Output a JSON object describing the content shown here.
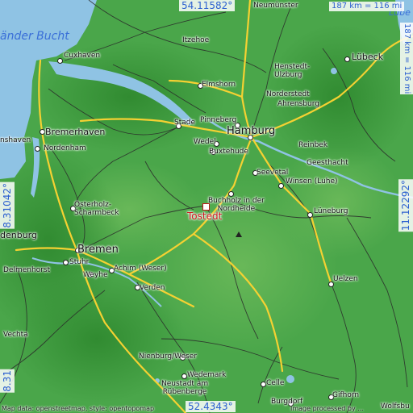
{
  "colors": {
    "water": "#8fc3e4",
    "land_high": "#4aa64a",
    "land_low": "#2f8a2f",
    "road_major": "#f5d132",
    "road_minor": "#2a2a2a",
    "highlight": "#d0171c",
    "coord_text": "#2b5fd0"
  },
  "coords": {
    "top": "54.11582°",
    "bottom": "52.4343°",
    "left": "8.31042°",
    "right": "11.12292°",
    "left_bottom": "8.31"
  },
  "scale": {
    "horizontal": "187 km = 116 mi",
    "vertical": "187 km = 116 mi"
  },
  "highlight": {
    "name": "Tostedt"
  },
  "water_labels": {
    "bight": "änder Bucht",
    "river": "Lübe"
  },
  "places": {
    "neumunster": "Neumünster",
    "itzehoe": "Itzehoe",
    "cuxhaven": "Cuxhaven",
    "henstedt": "Henstedt-\nUlzburg",
    "lubeck": "Lübeck",
    "elmshorn": "Elmshorn",
    "norderstedt": "Norderstedt",
    "ahrensburg": "Ahrensburg",
    "bremerhaven": "Bremerhaven",
    "stade": "Stade",
    "pinneberg": "Pinneberg",
    "hamburg": "Hamburg",
    "nordenham": "Nordenham",
    "wedel": "Wedel",
    "buxtehude": "Buxtehude",
    "reinbek": "Reinbek",
    "geesthacht": "Geesthacht",
    "seevetal": "Seevetal",
    "winsen": "Winsen (Luhe)",
    "buchholz": "Buchholz in der\nNordheide",
    "osterholz": "Osterholz-\nScharmbeck",
    "luneburg": "Lüneburg",
    "oldenburg": "denburg",
    "bremen": "Bremen",
    "stuhr": "Stuhr",
    "delmenhorst": "Delmenhorst",
    "achim": "Achim (Weser)",
    "weyhe": "Weyhe",
    "verden": "Verden",
    "uelzen": "Uelzen",
    "vechta": "Vechta",
    "nienburg": "Nienburg/Weser",
    "celle": "Celle",
    "wedemark": "Wedemark",
    "neustadt": "Neustadt am\nRübenberge",
    "gifhorn": "Gifhorn",
    "burgdorf": "Burgdorf",
    "shaven": "nshaven",
    "wolfsburg": "Wolfsbu"
  },
  "credits": {
    "left": "Map data: openstreetmap, style: opentopomap",
    "right": "Image processed by ..."
  }
}
